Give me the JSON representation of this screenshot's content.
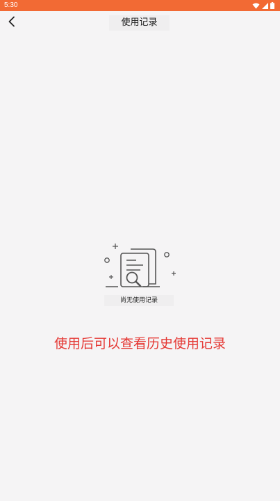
{
  "status_bar": {
    "time": "5:30",
    "icons": [
      "wifi-icon",
      "signal-icon",
      "battery-icon"
    ]
  },
  "header": {
    "title": "使用记录",
    "back_icon": "chevron-left-icon"
  },
  "empty_state": {
    "illustration_icon": "document-search-icon",
    "label": "尚无使用记录"
  },
  "hint": {
    "text": "使用后可以查看历史使用记录"
  },
  "colors": {
    "status_bar": "#f26a34",
    "background": "#f5f4f5",
    "hint_text": "#e53935"
  }
}
